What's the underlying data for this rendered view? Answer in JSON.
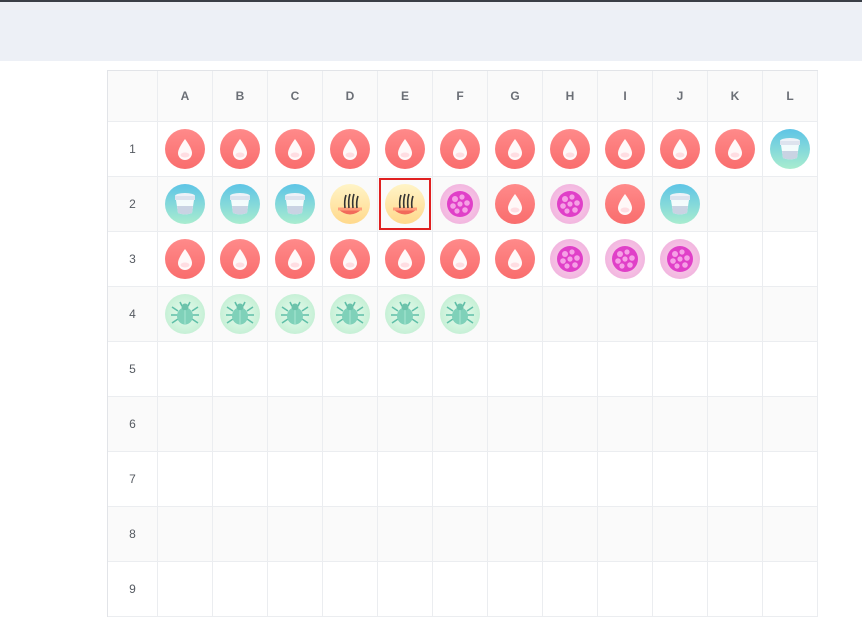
{
  "columns": [
    "A",
    "B",
    "C",
    "D",
    "E",
    "F",
    "G",
    "H",
    "I",
    "J",
    "K",
    "L"
  ],
  "rows": [
    {
      "label": "1",
      "wells": [
        "blood-drop-icon",
        "blood-drop-icon",
        "blood-drop-icon",
        "blood-drop-icon",
        "blood-drop-icon",
        "blood-drop-icon",
        "blood-drop-icon",
        "blood-drop-icon",
        "blood-drop-icon",
        "blood-drop-icon",
        "blood-drop-icon",
        "specimen-cup-icon"
      ]
    },
    {
      "label": "2",
      "wells": [
        "specimen-cup-icon",
        "specimen-cup-icon",
        "specimen-cup-icon",
        "hair-follicle-icon",
        "hair-follicle-icon",
        "cell-cluster-icon",
        "blood-drop-icon",
        "cell-cluster-icon",
        "blood-drop-icon",
        "specimen-cup-icon",
        "",
        ""
      ]
    },
    {
      "label": "3",
      "wells": [
        "blood-drop-icon",
        "blood-drop-icon",
        "blood-drop-icon",
        "blood-drop-icon",
        "blood-drop-icon",
        "blood-drop-icon",
        "blood-drop-icon",
        "cell-cluster-icon",
        "cell-cluster-icon",
        "cell-cluster-icon",
        "",
        ""
      ]
    },
    {
      "label": "4",
      "wells": [
        "mite-icon",
        "mite-icon",
        "mite-icon",
        "mite-icon",
        "mite-icon",
        "mite-icon",
        "",
        "",
        "",
        "",
        "",
        ""
      ]
    },
    {
      "label": "5",
      "wells": [
        "",
        "",
        "",
        "",
        "",
        "",
        "",
        "",
        "",
        "",
        "",
        ""
      ]
    },
    {
      "label": "6",
      "wells": [
        "",
        "",
        "",
        "",
        "",
        "",
        "",
        "",
        "",
        "",
        "",
        ""
      ]
    },
    {
      "label": "7",
      "wells": [
        "",
        "",
        "",
        "",
        "",
        "",
        "",
        "",
        "",
        "",
        "",
        ""
      ]
    },
    {
      "label": "8",
      "wells": [
        "",
        "",
        "",
        "",
        "",
        "",
        "",
        "",
        "",
        "",
        "",
        ""
      ]
    },
    {
      "label": "9",
      "wells": [
        "",
        "",
        "",
        "",
        "",
        "",
        "",
        "",
        "",
        "",
        "",
        ""
      ]
    }
  ],
  "selected_well": {
    "row": "2",
    "column": "E"
  },
  "colors": {
    "selection": "#e02020",
    "blood_drop": "#ff7f7f",
    "specimen_cup": "#7fd6d0",
    "hair_follicle": "#ffe7a6",
    "cell_cluster": "#f7c4e6",
    "mite": "#d3f5df",
    "header_bg": "#edf0f6"
  }
}
